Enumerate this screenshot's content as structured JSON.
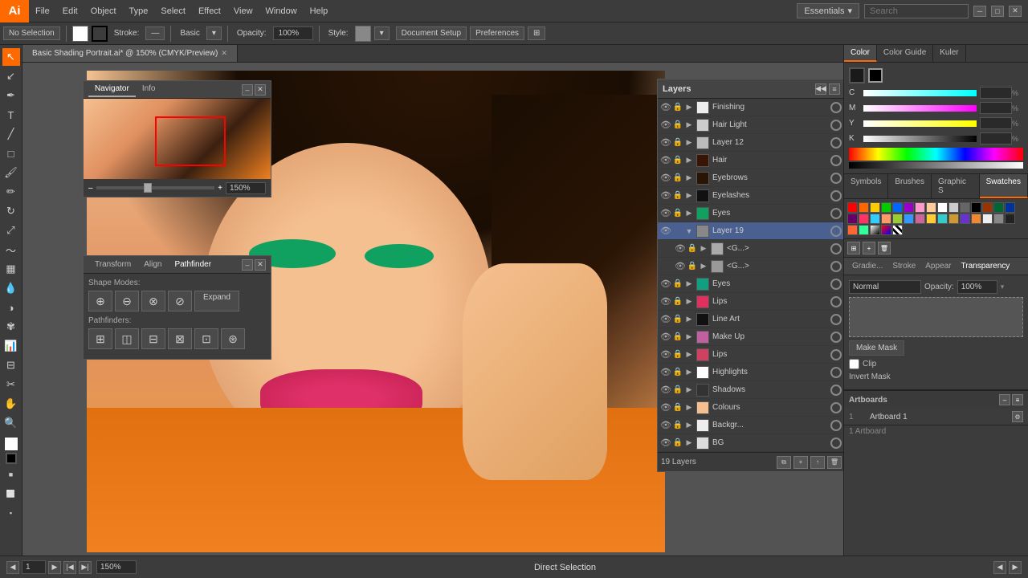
{
  "app": {
    "logo": "Ai",
    "logo_bg": "#ff6a00"
  },
  "menu": {
    "items": [
      "File",
      "Edit",
      "Object",
      "Type",
      "Select",
      "Effect",
      "View",
      "Window",
      "Help"
    ]
  },
  "toolbar": {
    "no_selection": "No Selection",
    "stroke_label": "Stroke:",
    "basic_label": "Basic",
    "opacity_label": "Opacity:",
    "opacity_value": "100%",
    "style_label": "Style:",
    "doc_setup_label": "Document Setup",
    "preferences_label": "Preferences",
    "essentials_label": "Essentials"
  },
  "tab": {
    "title": "Basic Shading Portrait.ai* @ 150% (CMYK/Preview)"
  },
  "layers": {
    "title": "Layers",
    "items": [
      {
        "name": "Finishing",
        "visible": true,
        "locked": true
      },
      {
        "name": "Hair Light",
        "visible": true,
        "locked": true
      },
      {
        "name": "Layer 12",
        "visible": true,
        "locked": true
      },
      {
        "name": "Hair",
        "visible": true,
        "locked": true
      },
      {
        "name": "Eyebrows",
        "visible": true,
        "locked": true
      },
      {
        "name": "Eyelashes",
        "visible": true,
        "locked": true
      },
      {
        "name": "Eyes",
        "visible": true,
        "locked": true
      },
      {
        "name": "Layer 19",
        "visible": true,
        "locked": false,
        "active": true
      },
      {
        "name": "<G...>",
        "visible": true,
        "locked": true,
        "child": true
      },
      {
        "name": "<G...>",
        "visible": true,
        "locked": true,
        "child": true
      },
      {
        "name": "Eyes",
        "visible": true,
        "locked": true
      },
      {
        "name": "Lips",
        "visible": true,
        "locked": true
      },
      {
        "name": "Line Art",
        "visible": true,
        "locked": true
      },
      {
        "name": "Make Up",
        "visible": true,
        "locked": true
      },
      {
        "name": "Lips",
        "visible": true,
        "locked": true
      },
      {
        "name": "Highlights",
        "visible": true,
        "locked": true
      },
      {
        "name": "Shadows",
        "visible": true,
        "locked": true
      },
      {
        "name": "Colours",
        "visible": true,
        "locked": true
      },
      {
        "name": "Backgr...",
        "visible": true,
        "locked": true
      },
      {
        "name": "BG",
        "visible": true,
        "locked": true
      }
    ],
    "count_label": "19 Layers"
  },
  "navigator": {
    "tabs": [
      "Navigator",
      "Info"
    ],
    "zoom_value": "150%"
  },
  "pathfinder": {
    "tabs": [
      "Transform",
      "Align",
      "Pathfinder"
    ],
    "shape_modes_label": "Shape Modes:",
    "pathfinders_label": "Pathfinders:",
    "expand_label": "Expand"
  },
  "color_panel": {
    "tabs": [
      "Color",
      "Color Guide",
      "Kuler"
    ],
    "c_label": "C",
    "m_label": "M",
    "y_label": "Y",
    "k_label": "K",
    "c_value": "",
    "m_value": "",
    "y_value": "",
    "k_value": ""
  },
  "swatches": {
    "tab_label": "Swatches"
  },
  "transparency": {
    "tabs": [
      "Gradie...",
      "Stroke",
      "Appear",
      "Transparency"
    ],
    "blend_mode": "Normal",
    "opacity_label": "Opacity:",
    "opacity_value": "100%",
    "make_mask_label": "Make Mask",
    "clip_label": "Clip",
    "invert_mask_label": "Invert Mask"
  },
  "artboards": {
    "title": "Artboards",
    "items": [
      {
        "num": "1",
        "name": "Artboard 1"
      }
    ],
    "count_label": "1 Artboard"
  },
  "status_bar": {
    "zoom_value": "150%",
    "page_value": "1",
    "tool_label": "Direct Selection",
    "nav_prev": "◀",
    "nav_next": "▶"
  }
}
